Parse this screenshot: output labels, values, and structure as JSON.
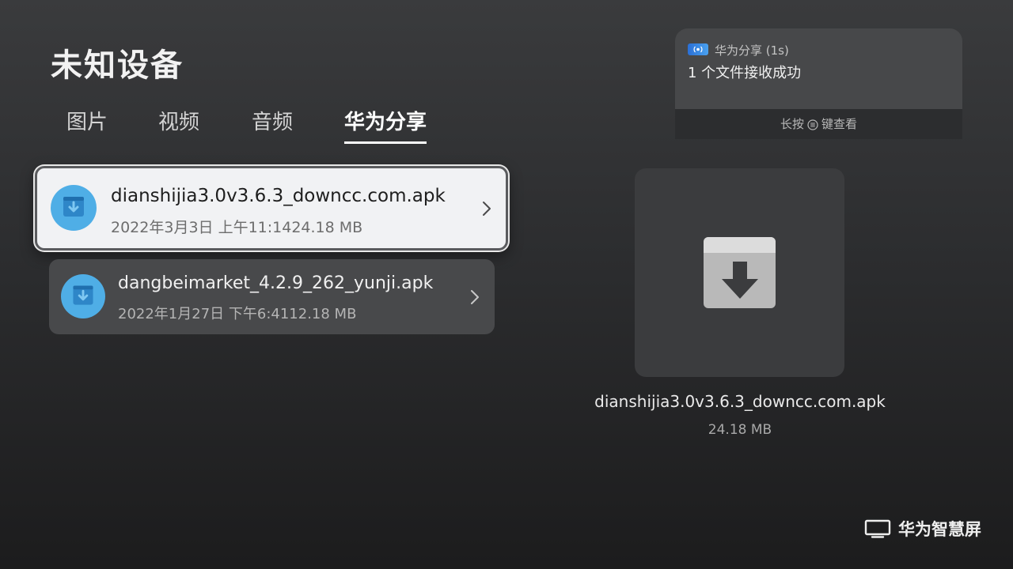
{
  "page": {
    "title": "未知设备"
  },
  "tabs": [
    {
      "label": "图片",
      "active": false
    },
    {
      "label": "视频",
      "active": false
    },
    {
      "label": "音频",
      "active": false
    },
    {
      "label": "华为分享",
      "active": true
    }
  ],
  "files": [
    {
      "name": "dianshijia3.0v3.6.3_downcc.com.apk",
      "meta": "2022年3月3日 上午11:1424.18 MB",
      "icon": "file-download-icon",
      "focused": true
    },
    {
      "name": "dangbeimarket_4.2.9_262_yunji.apk",
      "meta": "2022年1月27日 下午6:4112.18 MB",
      "icon": "file-download-icon",
      "focused": false
    }
  ],
  "preview": {
    "name": "dianshijia3.0v3.6.3_downcc.com.apk",
    "size": "24.18 MB",
    "icon": "download-box-icon"
  },
  "notification": {
    "app_name": "华为分享 (1s)",
    "message": "1 个文件接收成功",
    "hint_prefix": "长按",
    "hint_suffix": "键查看",
    "icon": "huawei-share-icon",
    "hint_icon": "menu-key-icon"
  },
  "brand": {
    "label": "华为智慧屏",
    "icon": "tv-icon"
  },
  "colors": {
    "accent_blue": "#4faee6",
    "icon_dark_blue": "#2e86c8",
    "focused_row": "#f1f2f4",
    "row": "#48494b"
  }
}
